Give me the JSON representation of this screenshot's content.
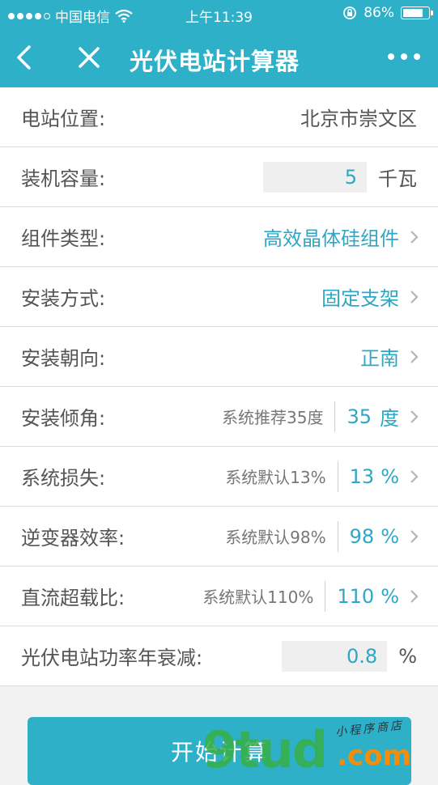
{
  "status_bar": {
    "carrier": "中国电信",
    "time": "上午11:39",
    "battery_percent": "86%",
    "battery_level": 0.86,
    "signal_bars_filled": 4,
    "signal_bars_total": 5
  },
  "nav": {
    "title": "光伏电站计算器",
    "back_icon": "chevron-left-icon",
    "close_icon": "close-icon",
    "more_icon": "more-dots-icon",
    "bar_color": "#2fb0c9"
  },
  "form": {
    "location": {
      "label": "电站位置:",
      "value": "北京市崇文区"
    },
    "capacity": {
      "label": "装机容量:",
      "value": "5",
      "unit": "千瓦"
    },
    "module_type": {
      "label": "组件类型:",
      "value": "高效晶体硅组件"
    },
    "mounting": {
      "label": "安装方式:",
      "value": "固定支架"
    },
    "orientation": {
      "label": "安装朝向:",
      "value": "正南"
    },
    "tilt": {
      "label": "安装倾角:",
      "hint": "系统推荐35度",
      "value": "35",
      "unit": "度"
    },
    "loss": {
      "label": "系统损失:",
      "hint": "系统默认13%",
      "value": "13",
      "unit": "%"
    },
    "inverter": {
      "label": "逆变器效率:",
      "hint": "系统默认98%",
      "value": "98",
      "unit": "%"
    },
    "dc_ratio": {
      "label": "直流超载比:",
      "hint": "系统默认110%",
      "value": "110",
      "unit": "%"
    },
    "degradation": {
      "label": "光伏电站功率年衰减:",
      "value": "0.8",
      "unit": "%"
    }
  },
  "actions": {
    "start_label": "开始计算"
  },
  "watermark": {
    "main": "9tud",
    "domain": ".com",
    "script": "小程序商店"
  },
  "colors": {
    "accent": "#2fb0c9",
    "link": "#2fa7c4"
  }
}
